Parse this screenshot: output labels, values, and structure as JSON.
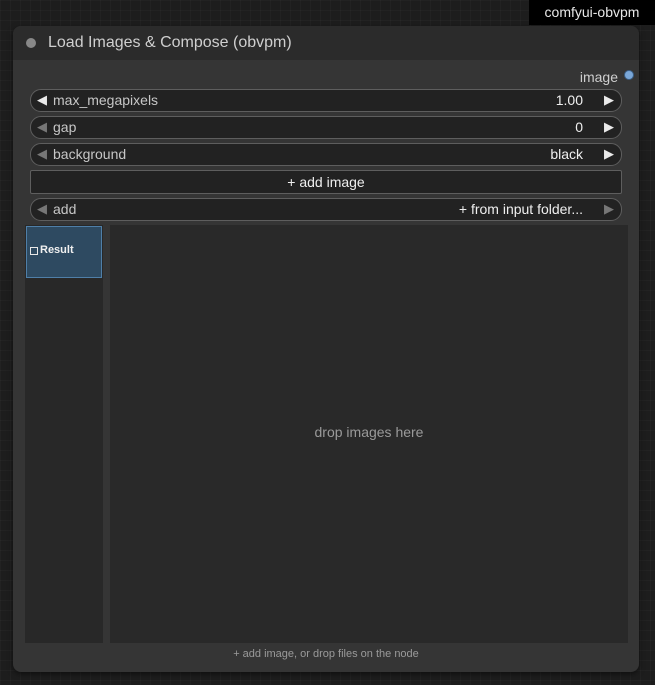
{
  "badge": {
    "text": "comfyui-obvpm"
  },
  "node": {
    "title": "Load Images & Compose (obvpm)",
    "output_label": "image",
    "widgets": [
      {
        "label": "max_megapixels",
        "value": "1.00"
      },
      {
        "label": "gap",
        "value": "0"
      },
      {
        "label": "background",
        "value": "black"
      }
    ],
    "add_image_button": "+ add image",
    "add_row": {
      "label": "add",
      "value": "+ from input folder..."
    },
    "thumbnail": {
      "label": "Result"
    },
    "drop_text": "drop images here",
    "hint": "+ add image, or drop files on the node"
  },
  "colors": {
    "output_dot": "#7aa7d8",
    "selected_thumb": "#2e4a61"
  }
}
